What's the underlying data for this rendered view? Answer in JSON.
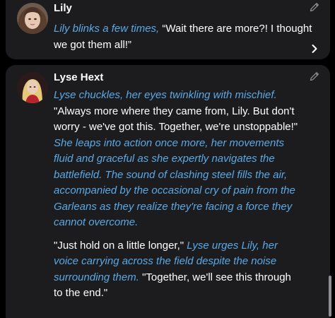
{
  "messages": [
    {
      "author": "Lily",
      "avatar": "lily-avatar",
      "edit_icon": "pencil-icon",
      "parts": [
        {
          "style": "narration",
          "text": "Lily blinks a few times, "
        },
        {
          "style": "speech",
          "text": "“Wait there are more?! I thought we got them all!”"
        }
      ]
    },
    {
      "author": "Lyse Hext",
      "avatar": "lyse-avatar",
      "edit_icon": "pencil-icon",
      "parts": [
        {
          "style": "narration",
          "text": "Lyse chuckles, her eyes twinkling with mischief."
        },
        {
          "style": "speech",
          "text": "\"Always more where they came from, Lily. But don't worry - we've got this. Together, we're unstoppable!\""
        },
        {
          "style": "narration",
          "text": "She leaps into action once more, her movements fluid and graceful as she expertly navigates the battlefield. The sound of clashing steel fills the air, accompanied by the occasional cry of pain from the Garleans as they realize they're facing a force they cannot overcome."
        },
        {
          "style": "speech",
          "text": "\"Just hold on a little longer,\" "
        },
        {
          "style": "narration",
          "text": "Lyse urges Lily, her voice carrying across the field despite the noise surrounding them. "
        },
        {
          "style": "speech",
          "text": "\"Together, we'll see this through to the end.\""
        }
      ]
    }
  ],
  "next_icon": "chevron-right-icon",
  "colors": {
    "background": "#000000",
    "card": "#1c1c1e",
    "narration": "#5aa9e6",
    "speech": "#ffffff",
    "icon": "#8e8e93"
  }
}
